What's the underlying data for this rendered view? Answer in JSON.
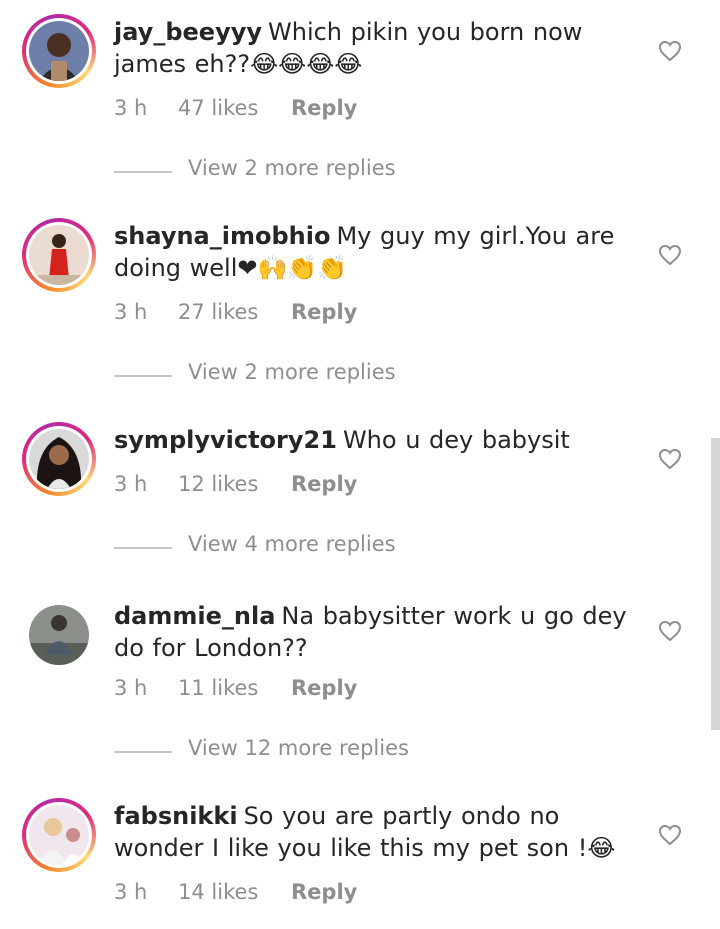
{
  "comments": [
    {
      "username": "jay_beeyyy",
      "text": "Which pikin you born now james eh??😂😂😂😂",
      "time": "3 h",
      "likes": "47 likes",
      "reply_label": "Reply",
      "view_replies": "View 2 more replies",
      "avatar_ring": true,
      "avatar_icon": "profile-photo"
    },
    {
      "username": "shayna_imobhio",
      "text": "My guy my girl.You are doing well❤🙌👏👏",
      "time": "3 h",
      "likes": "27 likes",
      "reply_label": "Reply",
      "view_replies": "View 2 more replies",
      "avatar_ring": true,
      "avatar_icon": "profile-photo"
    },
    {
      "username": "symplyvictory21",
      "text": "Who u dey babysit",
      "time": "3 h",
      "likes": "12 likes",
      "reply_label": "Reply",
      "view_replies": "View 4 more replies",
      "avatar_ring": true,
      "avatar_icon": "profile-photo"
    },
    {
      "username": "dammie_nla",
      "text": "Na babysitter work u go dey do for London??",
      "time": "3 h",
      "likes": "11 likes",
      "reply_label": "Reply",
      "view_replies": "View 12 more replies",
      "avatar_ring": false,
      "avatar_icon": "profile-photo"
    },
    {
      "username": "fabsnikki",
      "text": "So you are partly ondo no wonder I like you like this my pet son !😂",
      "time": "3 h",
      "likes": "14 likes",
      "reply_label": "Reply",
      "avatar_ring": true,
      "avatar_icon": "profile-photo"
    }
  ],
  "icons": {
    "like": "heart-outline-icon"
  },
  "colors": {
    "text": "#262626",
    "secondary_text": "#8e8e8e",
    "story_ring_start": "#f58529",
    "story_ring_end": "#dd2a7b"
  }
}
